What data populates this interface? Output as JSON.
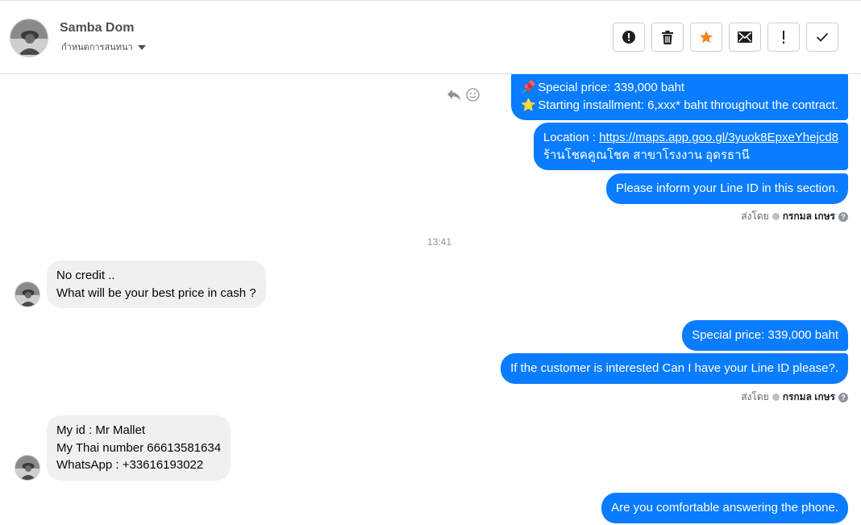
{
  "header": {
    "name": "Samba Dom",
    "subtitle": "กำหนดการสนทนา",
    "toolbar": [
      {
        "name": "spam-report-button",
        "icon": "exclamation-circle-icon"
      },
      {
        "name": "delete-button",
        "icon": "trash-icon"
      },
      {
        "name": "star-button",
        "icon": "star-icon",
        "color": "#f5821f"
      },
      {
        "name": "mark-unread-button",
        "icon": "envelope-icon"
      },
      {
        "name": "follow-up-button",
        "icon": "exclamation-icon"
      },
      {
        "name": "mark-done-button",
        "icon": "checkmark-icon"
      }
    ]
  },
  "colors": {
    "outgoing_bubble": "#0a7cff",
    "incoming_bubble": "#f0f0f0",
    "accent_star": "#f5821f"
  },
  "messages": {
    "m1": {
      "emoji1": "📌",
      "line1": "Special price: 339,000 baht",
      "emoji2": "⭐",
      "line2": "Starting installment: 6,xxx* baht throughout the contract."
    },
    "m2": {
      "prefix": "Location : ",
      "link": "https://maps.app.goo.gl/3yuok8EpxeYhejcd8",
      "line2": "ร้านโชคคูณโชค สาขาโรงงาน อุดรธานี"
    },
    "m3": "Please inform your Line ID in this section.",
    "sent_by_1": {
      "label": "ส่งโดย",
      "name": "กรกมล เกษร"
    },
    "timestamp": "13:41",
    "m4": {
      "line1": "No credit ..",
      "line2": "What will be your best price in cash ?"
    },
    "m5": "Special price: 339,000 baht",
    "m6": "If the customer is interested Can I have your Line ID please?.",
    "sent_by_2": {
      "label": "ส่งโดย",
      "name": "กรกมล เกษร"
    },
    "m7": {
      "line1": "My id : Mr Mallet",
      "line2": "My Thai number 66613581634",
      "line3": "WhatsApp : +33616193022"
    },
    "m8": "Are you comfortable answering the phone."
  }
}
